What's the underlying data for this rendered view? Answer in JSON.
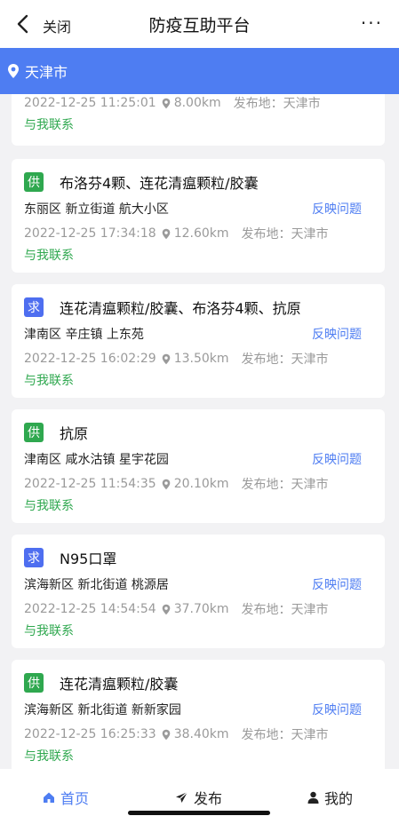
{
  "header": {
    "close_label": "关闭",
    "title": "防疫互助平台",
    "more_label": "···"
  },
  "location": {
    "city": "天津市"
  },
  "feed": {
    "first": {
      "time": "2022-12-25 11:25:01",
      "distance": "8.00km",
      "origin": "发布地：天津市",
      "contact": "与我联系"
    },
    "items": [
      {
        "type_label": "供",
        "type": "supply",
        "title": "布洛芬4颗、连花清瘟颗粒/胶囊",
        "address": "东丽区 新立街道 航大小区",
        "report": "反映问题",
        "time": "2022-12-25 17:34:18",
        "distance": "12.60km",
        "origin": "发布地：天津市",
        "contact": "与我联系"
      },
      {
        "type_label": "求",
        "type": "demand",
        "title": "连花清瘟颗粒/胶囊、布洛芬4颗、抗原",
        "address": "津南区 辛庄镇 上东苑",
        "report": "反映问题",
        "time": "2022-12-25 16:02:29",
        "distance": "13.50km",
        "origin": "发布地：天津市",
        "contact": "与我联系"
      },
      {
        "type_label": "供",
        "type": "supply",
        "title": "抗原",
        "address": "津南区 咸水沽镇 星宇花园",
        "report": "反映问题",
        "time": "2022-12-25 11:54:35",
        "distance": "20.10km",
        "origin": "发布地：天津市",
        "contact": "与我联系"
      },
      {
        "type_label": "求",
        "type": "demand",
        "title": "N95口罩",
        "address": "滨海新区 新北街道 桃源居",
        "report": "反映问题",
        "time": "2022-12-25 14:54:54",
        "distance": "37.70km",
        "origin": "发布地：天津市",
        "contact": "与我联系"
      },
      {
        "type_label": "供",
        "type": "supply",
        "title": "连花清瘟颗粒/胶囊",
        "address": "滨海新区 新北街道 新新家园",
        "report": "反映问题",
        "time": "2022-12-25 16:25:33",
        "distance": "38.40km",
        "origin": "发布地：天津市",
        "contact": "与我联系"
      }
    ]
  },
  "tabbar": {
    "home": "首页",
    "publish": "发布",
    "mine": "我的"
  },
  "colors": {
    "accent": "#4e7df2",
    "supply": "#2fa84f",
    "demand": "#4e6ef0"
  }
}
